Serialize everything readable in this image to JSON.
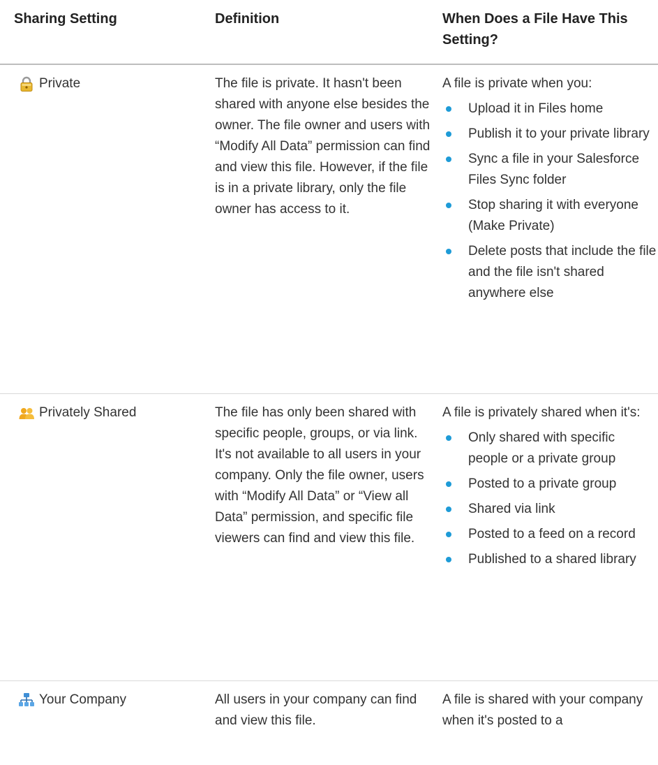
{
  "headers": {
    "setting": "Sharing Setting",
    "definition": "Definition",
    "when": "When Does a File Have This Setting?"
  },
  "rows": [
    {
      "icon": "lock-icon",
      "setting": "Private",
      "definition": "The file is private. It hasn't been shared with anyone else besides the owner. The file owner and users with “Modify All Data” permission can find and view this file. However, if the file is in a private library, only the file owner has access to it.",
      "intro": "A file is private when you:",
      "bullets": [
        "Upload it in Files home",
        "Publish it to your private library",
        "Sync a file in your Salesforce Files Sync folder",
        "Stop sharing it with everyone (Make Private)",
        "Delete posts that include the file and the file isn't shared anywhere else"
      ]
    },
    {
      "icon": "people-icon",
      "setting": "Privately Shared",
      "definition": "The file has only been shared with specific people, groups, or via link. It's not available to all users in your company. Only the file owner, users with “Modify All Data” or “View all Data” permission, and specific file viewers can find and view this file.",
      "intro": "A file is privately shared when it's:",
      "bullets": [
        "Only shared with specific people or a private group",
        "Posted to a private group",
        "Shared via link",
        "Posted to a feed on a record",
        "Published to a shared library"
      ]
    },
    {
      "icon": "company-hierarchy-icon",
      "setting": "Your Company",
      "definition": "All users in your company can find and view this file.",
      "intro": "A file is shared with your company when it's posted to a",
      "bullets": []
    }
  ],
  "colors": {
    "bullet": "#1e9bd7",
    "lock": "#e8b830",
    "people": "#f0a81e",
    "hierarchy": "#3f8fd6"
  }
}
